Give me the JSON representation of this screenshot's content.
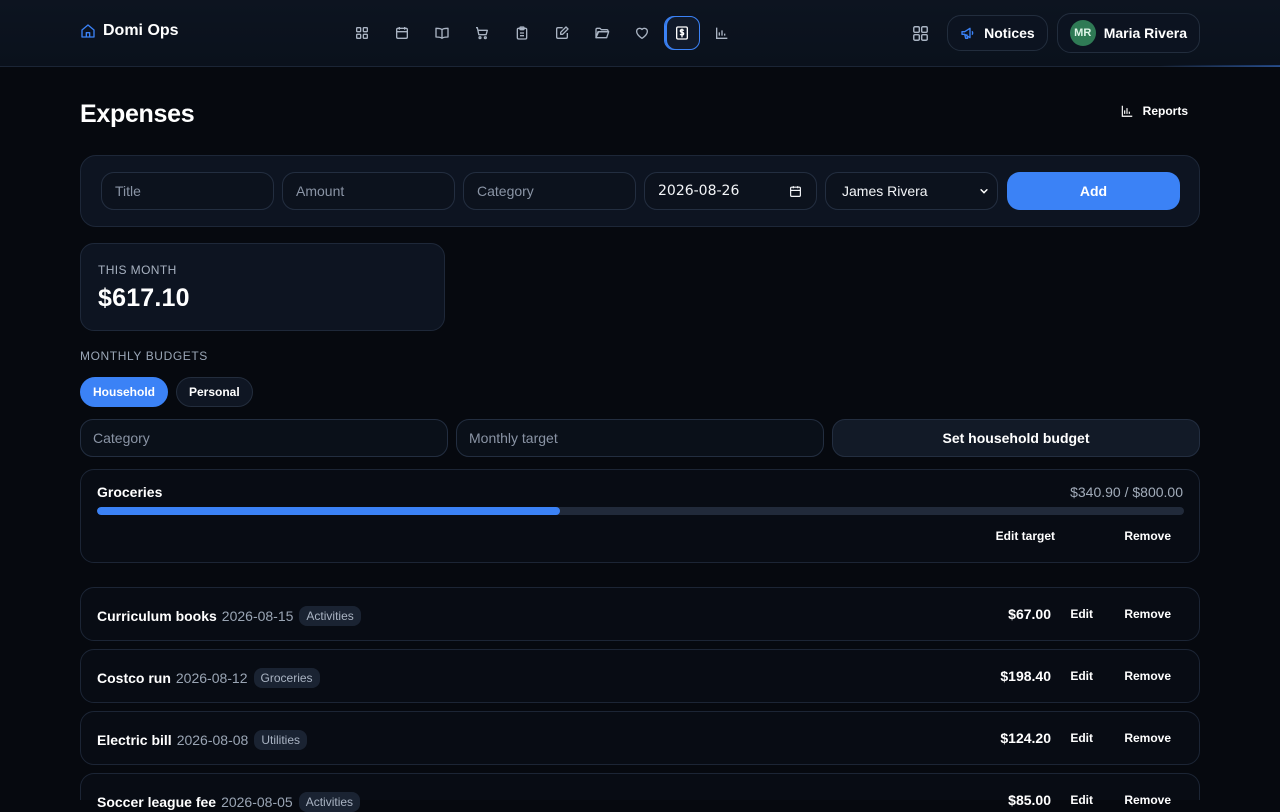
{
  "app": {
    "name": "Domi Ops"
  },
  "nav": {
    "icons": [
      "dashboard-icon",
      "calendar-icon",
      "book-icon",
      "cart-icon",
      "clipboard-icon",
      "edit-note-icon",
      "folder-icon",
      "heart-icon",
      "dollar-icon",
      "chart-icon"
    ],
    "active": "dollar-icon"
  },
  "header": {
    "notices_label": "Notices",
    "user_initials": "MR",
    "user_name": "Maria Rivera"
  },
  "page": {
    "title": "Expenses",
    "reports_label": "Reports"
  },
  "add_form": {
    "title_placeholder": "Title",
    "amount_placeholder": "Amount",
    "category_placeholder": "Category",
    "date_value": "2026-08-26",
    "payer_value": "James Rivera",
    "add_label": "Add"
  },
  "summary": {
    "label": "THIS MONTH",
    "value": "$617.10"
  },
  "budgets": {
    "section_label": "MONTHLY BUDGETS",
    "tabs": [
      {
        "label": "Household",
        "active": true
      },
      {
        "label": "Personal",
        "active": false
      }
    ],
    "category_placeholder": "Category",
    "target_placeholder": "Monthly target",
    "set_label": "Set household budget",
    "items": [
      {
        "name": "Groceries",
        "amount": "$340.90 / $800.00",
        "progress": 0.426,
        "edit_label": "Edit target",
        "remove_label": "Remove"
      }
    ]
  },
  "expenses": [
    {
      "title": "Curriculum books",
      "date": "2026-08-15",
      "category": "Activities",
      "amount": "$67.00",
      "edit": "Edit",
      "remove": "Remove"
    },
    {
      "title": "Costco run",
      "date": "2026-08-12",
      "category": "Groceries",
      "amount": "$198.40",
      "edit": "Edit",
      "remove": "Remove"
    },
    {
      "title": "Electric bill",
      "date": "2026-08-08",
      "category": "Utilities",
      "amount": "$124.20",
      "edit": "Edit",
      "remove": "Remove"
    },
    {
      "title": "Soccer league fee",
      "date": "2026-08-05",
      "category": "Activities",
      "amount": "$85.00",
      "edit": "Edit",
      "remove": "Remove"
    }
  ],
  "colors": {
    "accent": "#3b82f6",
    "background": "#06090f",
    "avatar": "#2f7a55"
  }
}
